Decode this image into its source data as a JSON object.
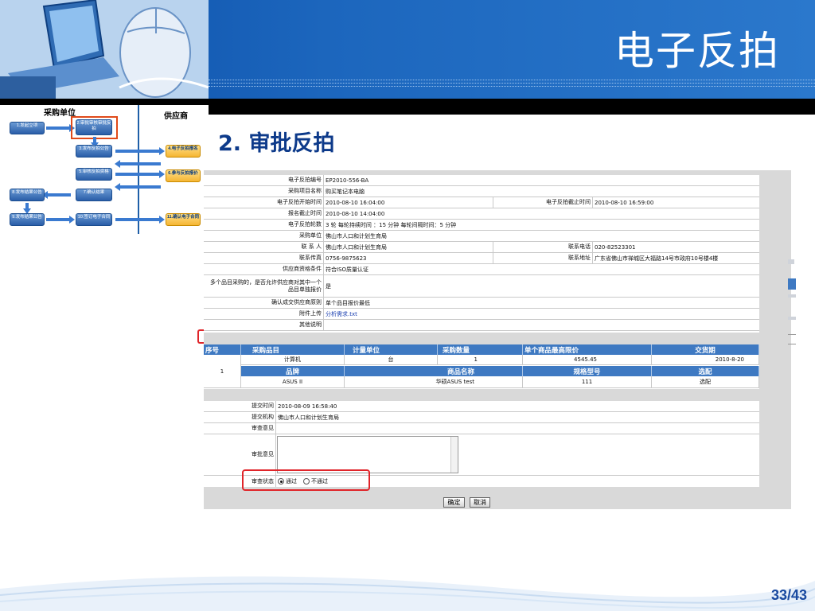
{
  "slide": {
    "title": "电子反拍",
    "subtitle": "2. 审批反拍",
    "page_number": "33/43"
  },
  "flowchart": {
    "lane_buyer": "采购单位",
    "lane_supplier": "供应商",
    "steps": [
      {
        "id": "s1",
        "label": "1.发起立项"
      },
      {
        "id": "s2",
        "label": "2.审批审核审批反拍"
      },
      {
        "id": "s3",
        "label": "3.发布反拍公告"
      },
      {
        "id": "s4",
        "label": "4.电子反拍报名"
      },
      {
        "id": "s5",
        "label": "5.审核反拍资格"
      },
      {
        "id": "s6",
        "label": "6.参与反拍报价"
      },
      {
        "id": "s7",
        "label": "7.确认结果"
      },
      {
        "id": "s8",
        "label": "8.发布结果公告"
      },
      {
        "id": "s9",
        "label": "9.发布结果公告"
      },
      {
        "id": "s10",
        "label": "10.签订电子合同"
      },
      {
        "id": "s11",
        "label": "11.确认电子合同"
      }
    ]
  },
  "form": {
    "rows": [
      {
        "label": "电子反拍编号",
        "value": "EP2010-556-BA"
      },
      {
        "label": "采购项目名称",
        "value": "购买笔记本电脑"
      },
      {
        "label": "电子反拍开始时间",
        "value": "2010-08-10 16:04:00",
        "label2": "电子反拍截止时间",
        "value2": "2010-08-10 16:59:00"
      },
      {
        "label": "报名截止时间",
        "value": "2010-08-10 14:04:00"
      },
      {
        "label": "电子反拍轮数",
        "value": "3 轮  每轮持续时间 ：15 分钟  每轮间隔时间：5 分钟"
      },
      {
        "label": "采购单位",
        "value": "佛山市人口和计划生育局"
      },
      {
        "label": "联 系 人",
        "value": "佛山市人口和计划生育局",
        "label2": "联系电话",
        "value2": "020-82523301"
      },
      {
        "label": "联系传真",
        "value": "0756-9875623",
        "label2": "联系地址",
        "value2": "广东省佛山市禅城区大福路14号市政府10号楼4楼"
      },
      {
        "label": "供应商资格条件",
        "value": "符合ISO质量认证"
      },
      {
        "label": "多个品目采购的，是否允许供应商对其中一个品目单独报价",
        "value": "是"
      },
      {
        "label": "确认成交供应商原则",
        "value": "单个品目报价最低"
      },
      {
        "label": "附件上传",
        "value": "分析需求.txt"
      },
      {
        "label": "其他说明",
        "value": ""
      }
    ]
  },
  "items_table": {
    "headers": [
      "序号",
      "采购品目",
      "计量单位",
      "采购数量",
      "单个商品最高限价",
      "交货期"
    ],
    "row": {
      "index": "1",
      "item": "计算机",
      "unit": "台",
      "qty": "1",
      "max_price": "4545.45",
      "delivery": "2010-8-20"
    },
    "sub_headers": [
      "品牌",
      "商品名称",
      "规格型号",
      "选配"
    ],
    "sub_row": {
      "brand": "ASUS II",
      "name": "华硕ASUS test",
      "model": "111",
      "option": "选配"
    }
  },
  "approval": {
    "submit_time_label": "提交时间",
    "submit_time": "2010-08-09 16:58:40",
    "submit_org_label": "提交机构",
    "submit_org": "佛山市人口和计划生育局",
    "review_opinion_label": "审查意见",
    "review_opinion": "",
    "approval_opinion_label": "审批意见",
    "approval_opinion": "",
    "status_label": "审查状态",
    "status_pass": "通过",
    "status_fail": "不通过",
    "selected_status": "通过"
  },
  "buttons": {
    "confirm": "确定",
    "cancel": "取消"
  },
  "colors": {
    "header_blue": "#1c66bd",
    "table_header_blue": "#3e79c2",
    "highlight_red": "#e0252a",
    "subtitle_blue": "#0d3a8a"
  }
}
